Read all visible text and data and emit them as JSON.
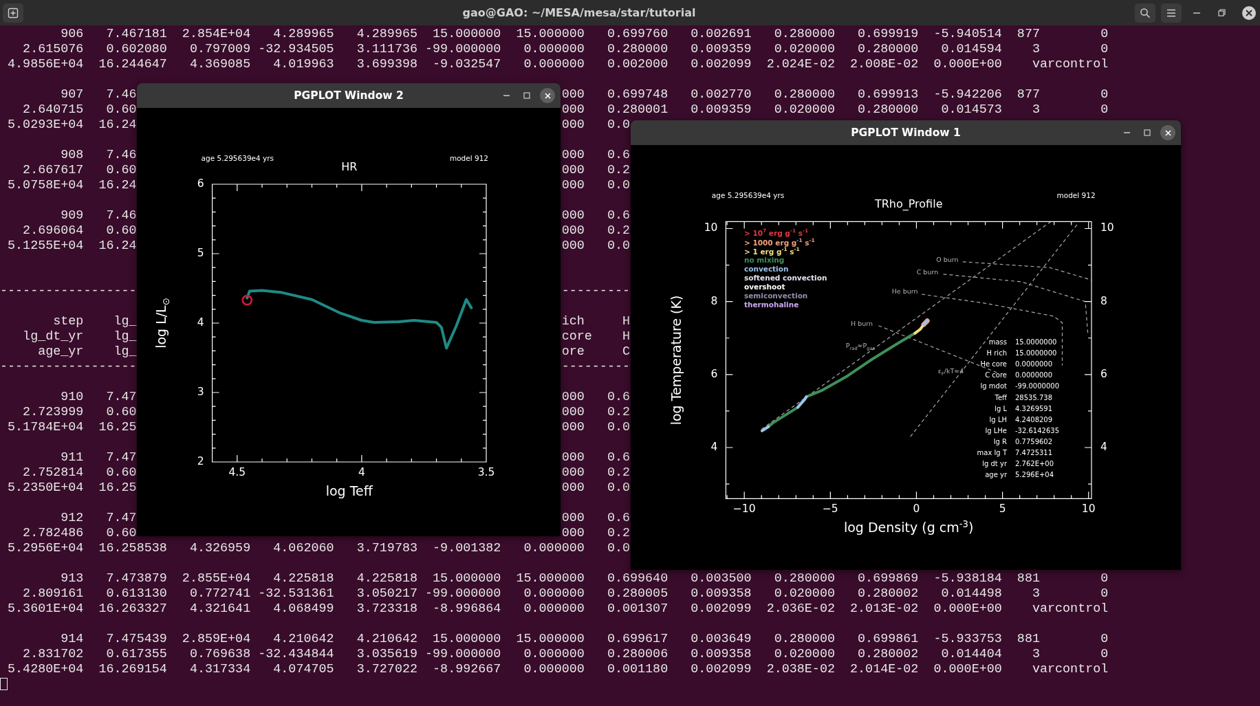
{
  "terminal": {
    "title": "gao@GAO: ~/MESA/mesa/star/tutorial",
    "lines": [
      {
        "kind": "full",
        "text": "        906   7.467181  2.854E+04   4.289965   4.289965  15.000000  15.000000   0.699760   0.002691   0.280000   0.699919  -5.940514  877        0"
      },
      {
        "kind": "full",
        "text": "   2.615076   0.602080   0.797009 -32.934505   3.111736 -99.000000   0.000000   0.280000   0.009359   0.020000   0.280000   0.014594    3        0"
      },
      {
        "kind": "full",
        "text": " 4.9856E+04  16.244647   4.369085   4.019963   3.699398  -9.032547   0.000000   0.002000   0.002099  2.024E-02  2.008E-02  0.000E+00    varcontrol"
      },
      {
        "kind": "blank"
      },
      {
        "kind": "split",
        "left": "        907   7.46",
        "right": "000   0.699748   0.002770   0.280000   0.699913  -5.942206  877        0"
      },
      {
        "kind": "split",
        "left": "   2.640715   0.60",
        "right": "000   0.280001   0.009359   0.020000   0.280000   0.014573    3        0"
      },
      {
        "kind": "split",
        "left": " 5.0293E+04  16.24",
        "right": "000   0.0"
      },
      {
        "kind": "blank"
      },
      {
        "kind": "split",
        "left": "        908   7.46",
        "right": "000   0.6"
      },
      {
        "kind": "split",
        "left": "   2.667617   0.60",
        "right": "000   0.2"
      },
      {
        "kind": "split",
        "left": " 5.0758E+04  16.24",
        "right": "000   0.0"
      },
      {
        "kind": "blank"
      },
      {
        "kind": "split",
        "left": "        909   7.46",
        "right": "000   0.6"
      },
      {
        "kind": "split",
        "left": "   2.696064   0.60",
        "right": "000   0.2"
      },
      {
        "kind": "split",
        "left": " 5.1255E+04  16.24",
        "right": "000   0.0"
      },
      {
        "kind": "blank"
      },
      {
        "kind": "blank"
      },
      {
        "kind": "split",
        "left": "------------------",
        "right": "---------"
      },
      {
        "kind": "blank"
      },
      {
        "kind": "split",
        "left": "       step    lg_",
        "right": "ich     H"
      },
      {
        "kind": "split",
        "left": "   lg_dt_yr    lg_",
        "right": "core    H"
      },
      {
        "kind": "split",
        "left": "     age_yr    lg_",
        "right": "ore     C"
      },
      {
        "kind": "split",
        "left": "------------------",
        "right": "---------"
      },
      {
        "kind": "blank"
      },
      {
        "kind": "split",
        "left": "        910   7.47",
        "right": "000   0.6"
      },
      {
        "kind": "split",
        "left": "   2.723999   0.60",
        "right": "000   0.2"
      },
      {
        "kind": "split",
        "left": " 5.1784E+04  16.25",
        "right": "000   0.0"
      },
      {
        "kind": "blank"
      },
      {
        "kind": "split",
        "left": "        911   7.47",
        "right": "000   0.6"
      },
      {
        "kind": "split",
        "left": "   2.752814   0.60",
        "right": "000   0.2"
      },
      {
        "kind": "split",
        "left": " 5.2350E+04  16.25",
        "right": "000   0.0"
      },
      {
        "kind": "blank"
      },
      {
        "kind": "split",
        "left": "        912   7.47",
        "right": "000   0.6"
      },
      {
        "kind": "split",
        "left": "   2.782486   0.60",
        "right": "000   0.2"
      },
      {
        "kind": "full",
        "text": " 5.2956E+04  16.258538   4.326959   4.062060   3.719783  -9.001382   0.000000   0.0"
      },
      {
        "kind": "blank"
      },
      {
        "kind": "full",
        "text": "        913   7.473879  2.855E+04   4.225818   4.225818  15.000000  15.000000   0.699640   0.003500   0.280000   0.699869  -5.938184  881        0"
      },
      {
        "kind": "full",
        "text": "   2.809161   0.613130   0.772741 -32.531361   3.050217 -99.000000   0.000000   0.280005   0.009358   0.020000   0.280002   0.014498    3        0"
      },
      {
        "kind": "full",
        "text": " 5.3601E+04  16.263327   4.321641   4.068499   3.723318  -8.996864   0.000000   0.001307   0.002099  2.036E-02  2.013E-02  0.000E+00    varcontrol"
      },
      {
        "kind": "blank"
      },
      {
        "kind": "full",
        "text": "        914   7.475439  2.859E+04   4.210642   4.210642  15.000000  15.000000   0.699617   0.003649   0.280000   0.699861  -5.933753  881        0"
      },
      {
        "kind": "full",
        "text": "   2.831702   0.617355   0.769638 -32.434844   3.035619 -99.000000   0.000000   0.280006   0.009358   0.020000   0.280002   0.014404    3        0"
      },
      {
        "kind": "full",
        "text": " 5.4280E+04  16.269154   4.317334   4.074705   3.727022  -8.992667   0.000000   0.001180   0.002099  2.038E-02  2.014E-02  0.000E+00    varcontrol"
      },
      {
        "kind": "cursor"
      }
    ]
  },
  "windows": [
    {
      "title": "PGPLOT Window 2",
      "age_label": "age 5.295639e4 yrs",
      "model_label": "model 912",
      "marker": true,
      "chart_data": {
        "type": "line",
        "title": "HR",
        "xlabel": "log Teff",
        "ylabel": "log L/L$_{⊙}$",
        "xlim": [
          4.6,
          3.5
        ],
        "ylim": [
          2,
          6
        ],
        "xticks": [
          4.5,
          4,
          3.5
        ],
        "yticks": [
          2,
          3,
          4,
          5,
          6
        ],
        "x": [
          3.56,
          3.58,
          3.62,
          3.66,
          3.68,
          3.7,
          3.79,
          3.85,
          3.95,
          4.0,
          4.09,
          4.2,
          4.32,
          4.4,
          4.45,
          4.46
        ],
        "series": [
          {
            "color": "#1f8a86",
            "values": [
              4.22,
              4.34,
              3.96,
              3.64,
              3.94,
              4.01,
              4.04,
              4.02,
              4.01,
              4.04,
              4.15,
              4.34,
              4.44,
              4.47,
              4.46,
              4.36
            ]
          }
        ]
      }
    },
    {
      "title": "PGPLOT Window 1",
      "age_label": "age 5.295639e4 yrs",
      "model_label": "model 912",
      "chart_data": {
        "type": "line",
        "title": "TRho_Profile",
        "xlabel": "log Density (g cm$^{-3}$)",
        "ylabel": "log Temperature (K)",
        "xlim": [
          -11.07,
          10.17
        ],
        "ylim": [
          2.6,
          10.19
        ],
        "xticks": [
          {
            "value": -10,
            "label": "−10"
          },
          {
            "value": -5,
            "label": "−5"
          },
          0,
          5,
          10
        ],
        "yticks": [
          4,
          6,
          8,
          10
        ],
        "y2lim": [
          2.6,
          10.19
        ],
        "y2ticks": [
          4,
          6,
          8,
          10
        ],
        "x": [
          -8.97,
          -8.6,
          -8.35,
          -6.9,
          -6.49,
          -6.39,
          -5.46,
          -4.01,
          -2.57,
          -0.92,
          -0.09,
          0.22,
          0.42,
          0.63
        ],
        "series": [
          {
            "color": "#f4a27a",
            "values": [
              null,
              null,
              null,
              null,
              null,
              null,
              null,
              null,
              null,
              null,
              null,
              null,
              7.37,
              7.47
            ]
          },
          {
            "color": "#3f8f5a",
            "values": [
              4.46,
              4.57,
              4.67,
              5.1,
              5.32,
              5.39,
              5.57,
              5.96,
              6.42,
              6.9,
              7.13,
              7.24,
              null,
              null
            ]
          },
          {
            "color": "#f0dc82",
            "values": [
              null,
              null,
              null,
              null,
              null,
              null,
              null,
              null,
              null,
              null,
              7.13,
              7.24,
              7.37,
              null
            ]
          },
          {
            "color": "#9cc3ec",
            "values": [
              4.46,
              4.57,
              null,
              5.1,
              5.32,
              5.39,
              null,
              null,
              null,
              null,
              null,
              null,
              7.37,
              7.47
            ]
          }
        ]
      },
      "curves": [
        {
          "label": "P$_{rad}$≈P$_{gas}$"
        },
        {
          "label": "ε$_{F}$/kT≈4"
        },
        {
          "label": "H burn"
        },
        {
          "label": "He burn"
        },
        {
          "label": "C burn"
        },
        {
          "label": "O burn"
        }
      ],
      "legend": [
        {
          "label": "> 10$^{7}$ erg g$^{-1}$ s$^{-1}$",
          "color": "#e5383b"
        },
        {
          "label": "> 1000 erg g$^{-1}$ s$^{-1}$",
          "color": "#f4a27a"
        },
        {
          "label": "> 1 erg g$^{-1}$ s$^{-1}$",
          "color": "#f0dc82"
        },
        {
          "label": "no mixing",
          "color": "#3f8f5a"
        },
        {
          "label": "convection",
          "color": "#9cc3ec"
        },
        {
          "label": "softened convection",
          "color": "#e4e4f0"
        },
        {
          "label": "overshoot",
          "color": "#ffffff"
        },
        {
          "label": "semiconvection",
          "color": "#9090a8"
        },
        {
          "label": "thermohaline",
          "color": "#c9a6f2"
        }
      ],
      "info": [
        {
          "key": "mass",
          "value": "15.0000000"
        },
        {
          "key": "H rich",
          "value": "15.0000000"
        },
        {
          "key": "He core",
          "value": "0.0000000"
        },
        {
          "key": "C core",
          "value": "0.0000000"
        },
        {
          "key": "lg mdot",
          "value": "-99.0000000"
        },
        {
          "key": "Teff",
          "value": "28535.738"
        },
        {
          "key": "lg L",
          "value": "4.3269591"
        },
        {
          "key": "lg LH",
          "value": "4.2408209"
        },
        {
          "key": "lg LHe",
          "value": "-32.6142635"
        },
        {
          "key": "lg R",
          "value": "0.7759602"
        },
        {
          "key": "max lg T",
          "value": "7.4725311"
        },
        {
          "key": "lg dt yr",
          "value": "2.762E+00"
        },
        {
          "key": "age yr",
          "value": "5.296E+04"
        }
      ]
    }
  ]
}
